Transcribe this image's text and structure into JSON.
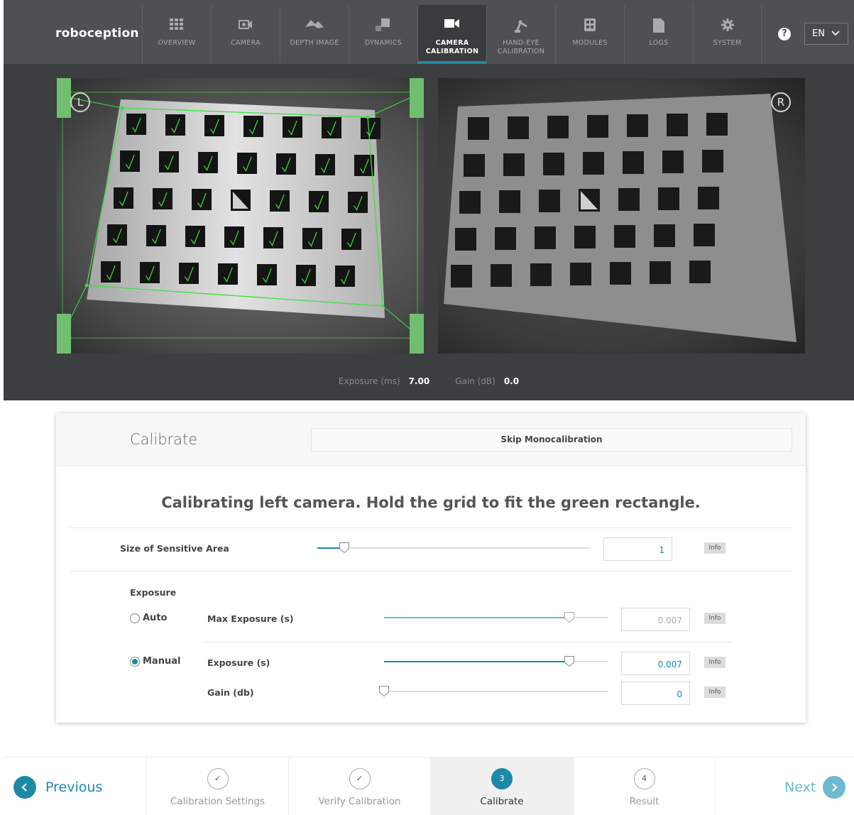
{
  "app": {
    "logo": "roboception"
  },
  "nav": {
    "tabs": [
      {
        "label": "OVERVIEW",
        "icon": "grid-icon"
      },
      {
        "label": "CAMERA",
        "icon": "camera-icon"
      },
      {
        "label": "DEPTH IMAGE",
        "icon": "depth-image-icon"
      },
      {
        "label": "DYNAMICS",
        "icon": "dynamics-icon"
      },
      {
        "label": "CAMERA CALIBRATION",
        "icon": "video-camera-icon"
      },
      {
        "label": "HAND-EYE CALIBRATION",
        "icon": "robot-arm-icon"
      },
      {
        "label": "MODULES",
        "icon": "modules-icon"
      },
      {
        "label": "LOGS",
        "icon": "document-icon"
      },
      {
        "label": "SYSTEM",
        "icon": "gear-icon"
      }
    ],
    "active_tab": "CAMERA CALIBRATION",
    "help": "?",
    "language": "EN"
  },
  "images": {
    "left_badge": "L",
    "right_badge": "R",
    "exposure_label": "Exposure (ms)",
    "exposure_value": "7.00",
    "gain_label": "Gain (dB)",
    "gain_value": "0.0"
  },
  "calibrate": {
    "title": "Calibrate",
    "skip_button": "Skip Monocalibration",
    "message": "Calibrating left camera. Hold the grid to fit the green rectangle.",
    "sensitive_area": {
      "label": "Size of Sensitive Area",
      "value": "1",
      "info": "Info",
      "level": 0.1
    },
    "exposure": {
      "label": "Exposure",
      "auto_label": "Auto",
      "manual_label": "Manual",
      "mode": "Manual",
      "max_exposure": {
        "label": "Max Exposure (s)",
        "value": "0.007",
        "info": "Info",
        "level": 0.83
      },
      "exposure_time": {
        "label": "Exposure (s)",
        "value": "0.007",
        "info": "Info",
        "level": 0.83
      },
      "gain": {
        "label": "Gain (db)",
        "value": "0",
        "info": "Info",
        "level": 0.0
      }
    }
  },
  "wizard": {
    "previous": "Previous",
    "next": "Next",
    "steps": [
      {
        "marker": "✓",
        "label": "Calibration Settings"
      },
      {
        "marker": "✓",
        "label": "Verify Calibration"
      },
      {
        "marker": "3",
        "label": "Calibrate"
      },
      {
        "marker": "4",
        "label": "Result"
      }
    ],
    "active_step": "Calibrate"
  },
  "colors": {
    "accent": "#1c89a9",
    "navbar": "#4f5053",
    "grid_overlay": "#3ce03c"
  }
}
